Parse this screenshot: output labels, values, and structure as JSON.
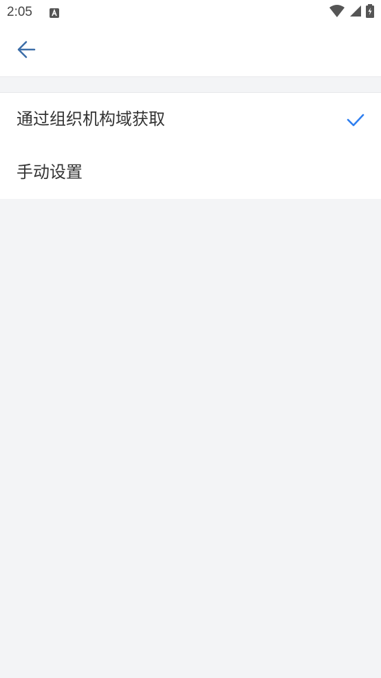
{
  "status_bar": {
    "time": "2:05",
    "icons": [
      "a-notification-icon",
      "wifi-icon",
      "cellular-signal-icon",
      "battery-charging-icon"
    ]
  },
  "app_bar": {
    "back_icon": "arrow-left-icon"
  },
  "options": [
    {
      "label": "通过组织机构域获取",
      "selected": true
    },
    {
      "label": "手动设置",
      "selected": false
    }
  ],
  "colors": {
    "accent": "#2f7ff0",
    "back_arrow": "#3d6ea8",
    "background": "#f3f4f6",
    "surface": "#ffffff",
    "text": "#333333"
  }
}
